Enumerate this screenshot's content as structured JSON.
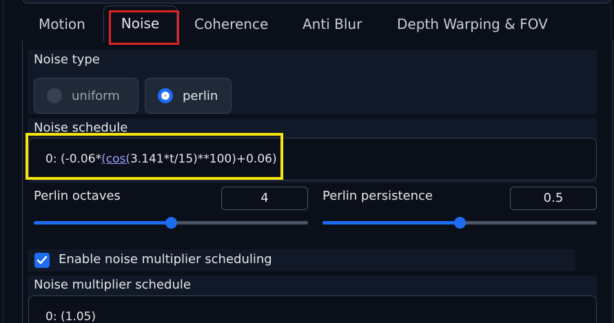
{
  "tabs": [
    {
      "label": "Motion",
      "active": false
    },
    {
      "label": "Noise",
      "active": true
    },
    {
      "label": "Coherence",
      "active": false
    },
    {
      "label": "Anti Blur",
      "active": false
    },
    {
      "label": "Depth Warping & FOV",
      "active": false
    }
  ],
  "noise_type": {
    "label": "Noise type",
    "options": [
      {
        "label": "uniform",
        "selected": false
      },
      {
        "label": "perlin",
        "selected": true
      }
    ]
  },
  "noise_schedule": {
    "label": "Noise schedule",
    "value_prefix": "0: (-0.06*",
    "value_link": "(cos(",
    "value_suffix": "3.141*t/15)**100)+0.06)"
  },
  "perlin_octaves": {
    "label": "Perlin octaves",
    "value": "4",
    "slider_fraction": 0.5
  },
  "perlin_persistence": {
    "label": "Perlin persistence",
    "value": "0.5",
    "slider_fraction": 0.5
  },
  "noise_multiplier_toggle": {
    "label": "Enable noise multiplier scheduling",
    "checked": true
  },
  "noise_multiplier_schedule": {
    "label": "Noise multiplier schedule",
    "value": "0: (1.05)"
  },
  "colors": {
    "accent": "#1d6cf2",
    "background": "#0b0f19",
    "block": "#111827",
    "highlight_red": "#e02424",
    "highlight_yellow": "#f5e50a"
  }
}
